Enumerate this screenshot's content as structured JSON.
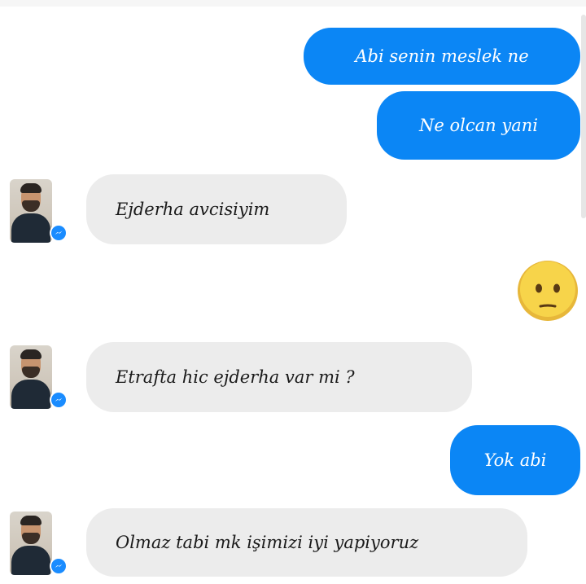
{
  "conversation": {
    "messages": [
      {
        "side": "out",
        "text": "Abi senin meslek ne"
      },
      {
        "side": "out",
        "text": "Ne olcan yani"
      },
      {
        "side": "in",
        "text": "Ejderha avcisiyim"
      },
      {
        "side": "out",
        "emoji": "neutral-face-emoji"
      },
      {
        "side": "in",
        "text": "Etrafta hic ejderha var mi ?"
      },
      {
        "side": "out",
        "text": "Yok abi"
      },
      {
        "side": "in",
        "text": "Olmaz tabi mk işimizi iyi yapiyoruz"
      }
    ]
  },
  "icons": {
    "avatar": "contact-avatar",
    "badge": "messenger-badge-icon",
    "emoji": "neutral-face-emoji"
  },
  "colors": {
    "outgoing_bubble": "#0b86f5",
    "incoming_bubble": "#ececec",
    "badge": "#1a8cff",
    "emoji": "#f7d44a"
  }
}
